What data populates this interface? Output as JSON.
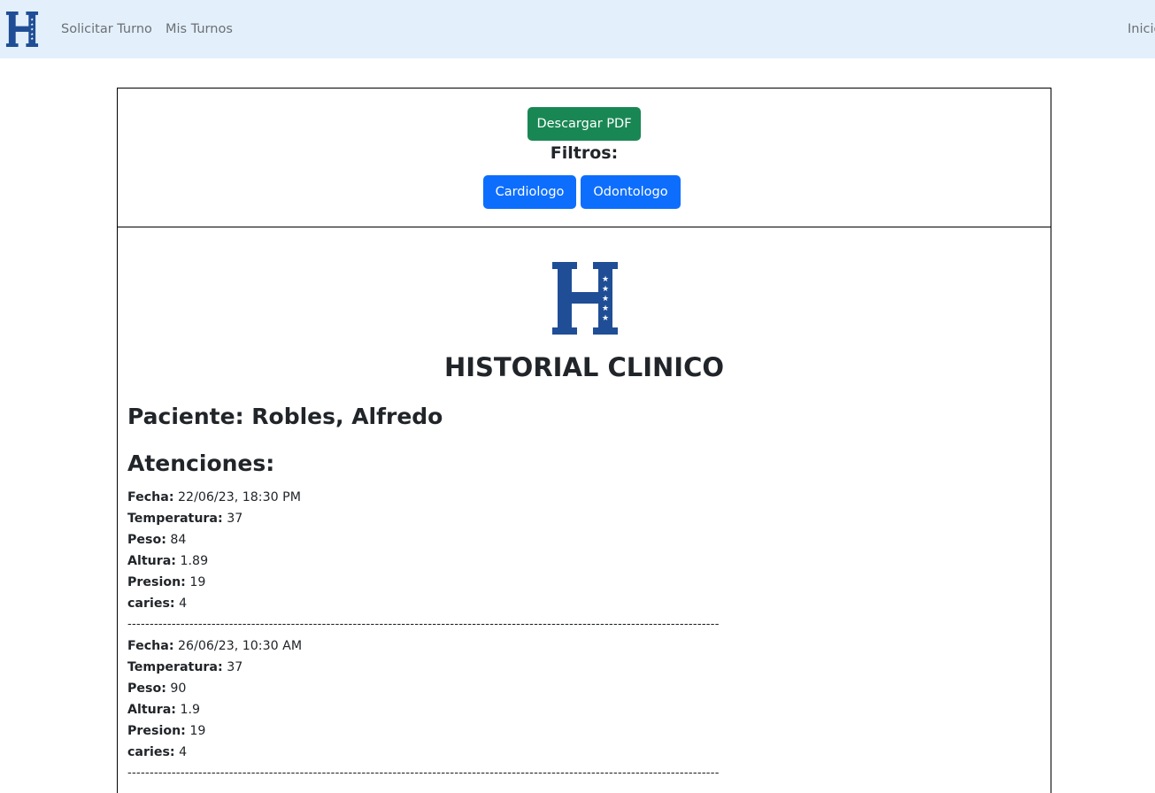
{
  "navbar": {
    "brand_icon": "hospital-h-logo",
    "links": [
      "Solicitar Turno",
      "Mis Turnos"
    ],
    "right_link": "Inicio"
  },
  "toolbar": {
    "download_label": "Descargar PDF",
    "filters_label": "Filtros:",
    "filters": [
      "Cardiologo",
      "Odontologo"
    ]
  },
  "report": {
    "title": "HISTORIAL CLINICO",
    "patient": "Paciente: Robles, Alfredo",
    "attentions_title": "Atenciones:",
    "separator": "--------------------------------------------------------------------------------------------------------------------------------------",
    "attentions": [
      {
        "fields": [
          {
            "label": "Fecha:",
            "value": "22/06/23, 18:30 PM"
          },
          {
            "label": "Temperatura:",
            "value": "37"
          },
          {
            "label": "Peso:",
            "value": "84"
          },
          {
            "label": "Altura:",
            "value": "1.89"
          },
          {
            "label": "Presion:",
            "value": "19"
          },
          {
            "label": "caries:",
            "value": "4"
          }
        ]
      },
      {
        "fields": [
          {
            "label": "Fecha:",
            "value": "26/06/23, 10:30 AM"
          },
          {
            "label": "Temperatura:",
            "value": "37"
          },
          {
            "label": "Peso:",
            "value": "90"
          },
          {
            "label": "Altura:",
            "value": "1.9"
          },
          {
            "label": "Presion:",
            "value": "19"
          },
          {
            "label": "caries:",
            "value": "4"
          }
        ]
      }
    ]
  },
  "colors": {
    "navbar_bg": "#e3f0fb",
    "logo_blue": "#1f4e96",
    "success": "#198754",
    "primary": "#0d6efd"
  }
}
